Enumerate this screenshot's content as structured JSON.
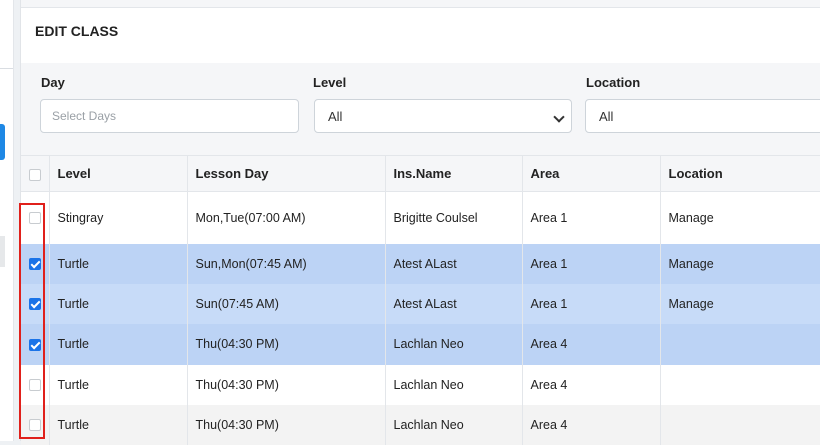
{
  "header": {
    "title": "EDIT CLASS"
  },
  "filters": {
    "day": {
      "label": "Day",
      "placeholder": "Select Days"
    },
    "level": {
      "label": "Level",
      "value": "All"
    },
    "location": {
      "label": "Location",
      "value": "All"
    }
  },
  "table": {
    "columns": [
      "Level",
      "Lesson Day",
      "Ins.Name",
      "Area",
      "Location"
    ],
    "rows": [
      {
        "checked": false,
        "level": "Stingray",
        "lesson_day": "Mon,Tue(07:00 AM)",
        "ins_name": "Brigitte Coulsel",
        "area": "Area 1",
        "location": "Manage"
      },
      {
        "checked": true,
        "level": "Turtle",
        "lesson_day": "Sun,Mon(07:45 AM)",
        "ins_name": "Atest ALast",
        "area": "Area 1",
        "location": "Manage"
      },
      {
        "checked": true,
        "level": "Turtle",
        "lesson_day": "Sun(07:45 AM)",
        "ins_name": "Atest ALast",
        "area": "Area 1",
        "location": "Manage"
      },
      {
        "checked": true,
        "level": "Turtle",
        "lesson_day": "Thu(04:30 PM)",
        "ins_name": "Lachlan Neo",
        "area": "Area 4",
        "location": ""
      },
      {
        "checked": false,
        "level": "Turtle",
        "lesson_day": "Thu(04:30 PM)",
        "ins_name": "Lachlan Neo",
        "area": "Area 4",
        "location": ""
      },
      {
        "checked": false,
        "level": "Turtle",
        "lesson_day": "Thu(04:30 PM)",
        "ins_name": "Lachlan Neo",
        "area": "Area 4",
        "location": ""
      }
    ]
  },
  "colors": {
    "selected_row": "#bcd3f5",
    "checkbox_checked": "#1a73e8",
    "highlight_box": "#e0201b"
  }
}
